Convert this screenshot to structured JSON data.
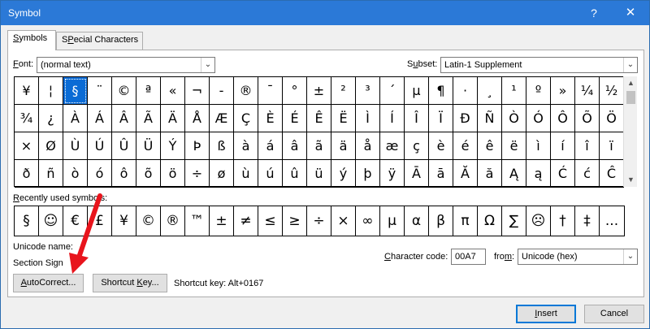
{
  "window": {
    "title": "Symbol",
    "help_glyph": "?",
    "close_glyph": "✕"
  },
  "tabs": [
    {
      "label": "Symbols",
      "accel": "S",
      "rest": "ymbols",
      "active": true
    },
    {
      "label": "Special Characters",
      "accel": "P",
      "pre": "S",
      "rest": "ecial Characters",
      "active": false
    }
  ],
  "font": {
    "label": "Font:",
    "accel": "F",
    "rest": "ont:",
    "value": "(normal text)"
  },
  "subset": {
    "label": "Subset:",
    "pre": "S",
    "accel": "u",
    "rest": "bset:",
    "value": "Latin-1 Supplement"
  },
  "symbol_grid": {
    "selected_index": 2,
    "rows": [
      [
        "¥",
        "¦",
        "§",
        "¨",
        "©",
        "ª",
        "«",
        "¬",
        "-",
        "®",
        "¯",
        "°",
        "±",
        "²",
        "³",
        "´",
        "µ",
        "¶",
        "·",
        "¸",
        "¹",
        "º",
        "»",
        "¼",
        "½"
      ],
      [
        "¾",
        "¿",
        "À",
        "Á",
        "Â",
        "Ã",
        "Ä",
        "Å",
        "Æ",
        "Ç",
        "È",
        "É",
        "Ê",
        "Ë",
        "Ì",
        "Í",
        "Î",
        "Ï",
        "Đ",
        "Ñ",
        "Ò",
        "Ó",
        "Ô",
        "Õ",
        "Ö"
      ],
      [
        "×",
        "Ø",
        "Ù",
        "Ú",
        "Û",
        "Ü",
        "Ý",
        "Þ",
        "ß",
        "à",
        "á",
        "â",
        "ã",
        "ä",
        "å",
        "æ",
        "ç",
        "è",
        "é",
        "ê",
        "ë",
        "ì",
        "í",
        "î",
        "ï"
      ],
      [
        "ð",
        "ñ",
        "ò",
        "ó",
        "ô",
        "õ",
        "ö",
        "÷",
        "ø",
        "ù",
        "ú",
        "û",
        "ü",
        "ý",
        "þ",
        "ÿ",
        "Ā",
        "ā",
        "Ă",
        "ă",
        "Ą",
        "ą",
        "Ć",
        "ć",
        "Ĉ"
      ]
    ]
  },
  "recent": {
    "label": "Recently used symbols:",
    "accel": "R",
    "rest": "ecently used symbols:",
    "symbols": [
      "§",
      "☺",
      "€",
      "£",
      "¥",
      "©",
      "®",
      "™",
      "±",
      "≠",
      "≤",
      "≥",
      "÷",
      "×",
      "∞",
      "µ",
      "α",
      "β",
      "π",
      "Ω",
      "∑",
      "☹",
      "†",
      "‡",
      "..."
    ]
  },
  "unicode_name": {
    "label": "Unicode name:",
    "value": "Section Sign"
  },
  "char_code": {
    "label": "Character code:",
    "accel": "C",
    "rest": "haracter code:",
    "value": "00A7"
  },
  "from": {
    "label": "from:",
    "accel": "m",
    "pre": "fro",
    "rest": ":",
    "value": "Unicode (hex)"
  },
  "buttons": {
    "autocorrect": "AutoCorrect...",
    "autocorrect_accel": "A",
    "autocorrect_rest": "utoCorrect...",
    "shortcut": "Shortcut Key...",
    "shortcut_pre": "Shortcut ",
    "shortcut_accel": "K",
    "shortcut_rest": "ey...",
    "insert": "Insert",
    "insert_accel": "I",
    "insert_rest": "nsert",
    "cancel": "Cancel"
  },
  "shortcut_key_text": "Shortcut key: Alt+0167",
  "colors": {
    "titlebar": "#2b79d7",
    "selection": "#0a6bd5",
    "annotation_arrow": "#e8141c"
  }
}
